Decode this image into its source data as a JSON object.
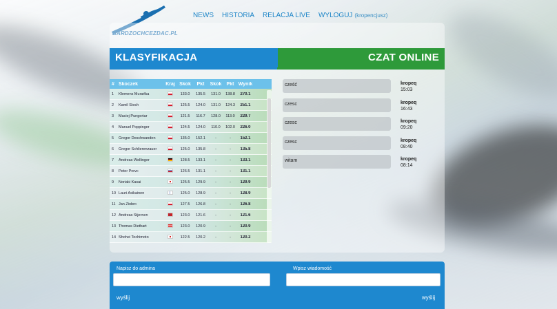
{
  "header": {
    "logo_text": "BARDZOCHCEZDAC.PL",
    "nav": [
      {
        "label": "NEWS"
      },
      {
        "label": "HISTORIA"
      },
      {
        "label": "RELACJA LIVE"
      },
      {
        "label": "WYLOGUJ"
      }
    ],
    "user_note": "(kropencjusz)"
  },
  "classification": {
    "title": "KLASYFIKACJA",
    "headers": {
      "num": "#",
      "name": "Skoczek",
      "country": "Kraj",
      "jump1": "Skok",
      "pts1": "Pkt",
      "jump2": "Skok",
      "pts2": "Pkt",
      "result": "Wynik"
    },
    "rows": [
      {
        "num": "1",
        "name": "Klemens Murańka",
        "flag": "pl",
        "jump1": "133.0",
        "pts1": "135.5",
        "jump2": "131.0",
        "pts2": "138.8",
        "result": "270.1"
      },
      {
        "num": "2",
        "name": "Kamil Stoch",
        "flag": "pl",
        "jump1": "125.5",
        "pts1": "124.0",
        "jump2": "131.0",
        "pts2": "124.3",
        "result": "251.1"
      },
      {
        "num": "3",
        "name": "Maciej Pungertar",
        "flag": "pl",
        "jump1": "121.5",
        "pts1": "116.7",
        "jump2": "128.0",
        "pts2": "113.0",
        "result": "229.7"
      },
      {
        "num": "4",
        "name": "Manuel Poppinger",
        "flag": "pl",
        "jump1": "124.5",
        "pts1": "124.0",
        "jump2": "110.0",
        "pts2": "102.0",
        "result": "226.0"
      },
      {
        "num": "5",
        "name": "Gregor Deschwanden",
        "flag": "pl",
        "jump1": "135.0",
        "pts1": "152.1",
        "jump2": "-",
        "pts2": "-",
        "result": "152.1"
      },
      {
        "num": "6",
        "name": "Gregor Schlierenzauer",
        "flag": "pl",
        "jump1": "125.0",
        "pts1": "135.8",
        "jump2": "-",
        "pts2": "-",
        "result": "135.8"
      },
      {
        "num": "7",
        "name": "Andreas Wellinger",
        "flag": "de",
        "jump1": "128.5",
        "pts1": "133.1",
        "jump2": "-",
        "pts2": "-",
        "result": "133.1"
      },
      {
        "num": "8",
        "name": "Peter Prevc",
        "flag": "ru",
        "jump1": "126.5",
        "pts1": "131.1",
        "jump2": "-",
        "pts2": "-",
        "result": "131.1"
      },
      {
        "num": "9",
        "name": "Noriaki Kasai",
        "flag": "jp",
        "jump1": "125.5",
        "pts1": "129.9",
        "jump2": "-",
        "pts2": "-",
        "result": "129.9"
      },
      {
        "num": "10",
        "name": "Lauri Asikainen",
        "flag": "fi",
        "jump1": "125.0",
        "pts1": "128.9",
        "jump2": "-",
        "pts2": "-",
        "result": "128.9"
      },
      {
        "num": "11",
        "name": "Jan Ziobro",
        "flag": "pl",
        "jump1": "127.5",
        "pts1": "126.8",
        "jump2": "-",
        "pts2": "-",
        "result": "126.8"
      },
      {
        "num": "12",
        "name": "Andreas Stjernen",
        "flag": "no",
        "jump1": "123.0",
        "pts1": "121.6",
        "jump2": "-",
        "pts2": "-",
        "result": "121.6"
      },
      {
        "num": "13",
        "name": "Thomas Diethart",
        "flag": "at",
        "jump1": "123.0",
        "pts1": "120.9",
        "jump2": "-",
        "pts2": "-",
        "result": "120.9"
      },
      {
        "num": "14",
        "name": "Shohei Tochimoto",
        "flag": "jp",
        "jump1": "122.5",
        "pts1": "120.2",
        "jump2": "-",
        "pts2": "-",
        "result": "120.2"
      }
    ]
  },
  "chat": {
    "title": "CZAT ONLINE",
    "messages": [
      {
        "text": "cześć",
        "user": "kropeq",
        "time": "15:03"
      },
      {
        "text": "czesc",
        "user": "kropeq",
        "time": "16:43"
      },
      {
        "text": "czesc",
        "user": "kropeq",
        "time": "09:20"
      },
      {
        "text": "czesc",
        "user": "kropeq",
        "time": "08:40"
      },
      {
        "text": "witam",
        "user": "kropeq",
        "time": "08:14"
      }
    ]
  },
  "footer": {
    "admin_label": "Napisz do admina",
    "admin_value": "",
    "admin_send": "wyślij",
    "chat_label": "Wpisz wiadomość",
    "chat_value": "",
    "chat_send": "wyślij"
  },
  "colors": {
    "blue": "#1e88cf",
    "green": "#2e9a3a",
    "table_head": "#6cc1ea"
  }
}
